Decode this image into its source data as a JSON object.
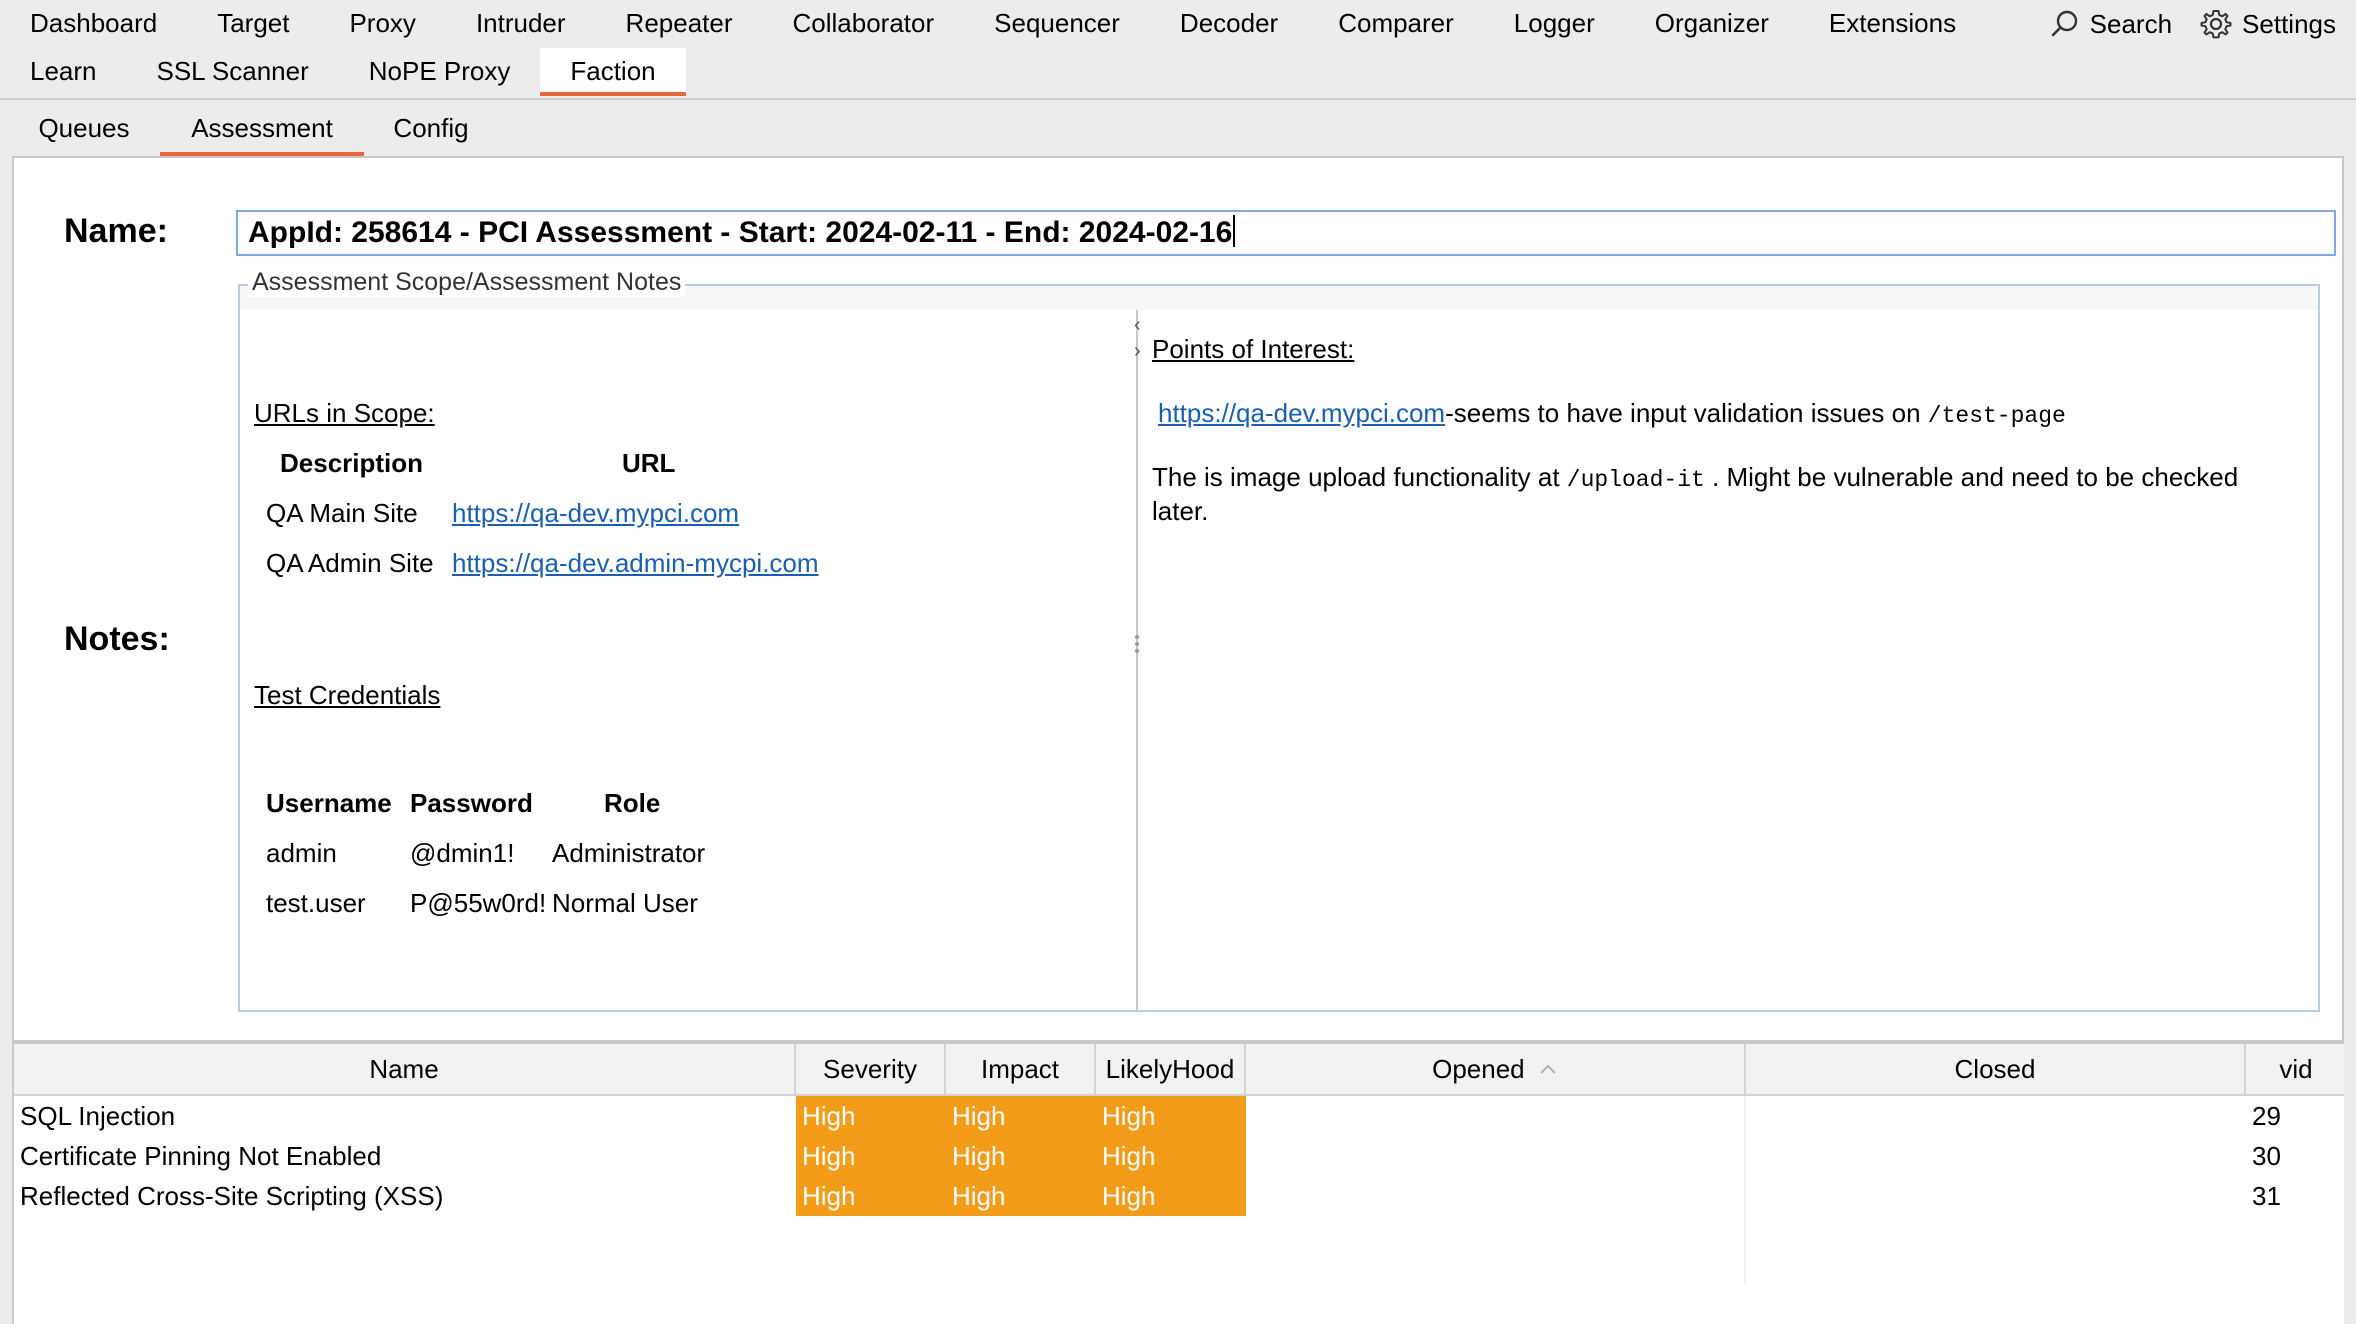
{
  "menu": {
    "row1": [
      "Dashboard",
      "Target",
      "Proxy",
      "Intruder",
      "Repeater",
      "Collaborator",
      "Sequencer",
      "Decoder",
      "Comparer",
      "Logger",
      "Organizer",
      "Extensions"
    ],
    "row2": [
      "Learn",
      "SSL Scanner",
      "NoPE Proxy",
      "Faction"
    ],
    "active": "Faction",
    "search_label": "Search",
    "settings_label": "Settings"
  },
  "subtabs": [
    "Queues",
    "Assessment",
    "Config"
  ],
  "active_subtab": "Assessment",
  "form": {
    "name_label": "Name:",
    "name_value": "AppId: 258614 - PCI Assessment - Start: 2024-02-11 - End: 2024-02-16",
    "notes_label": "Notes:",
    "notes_legend": "Assessment Scope/Assessment Notes"
  },
  "notes_left": {
    "urls_heading": "URLs in Scope:",
    "urls_headers": [
      "Description",
      "URL"
    ],
    "urls": [
      {
        "description": "QA Main Site",
        "url": "https://qa-dev.mypci.com"
      },
      {
        "description": "QA Admin Site",
        "url": "https://qa-dev.admin-mycpi.com"
      }
    ],
    "creds_heading": "Test Credentials",
    "creds_headers": [
      "Username",
      "Password",
      "Role"
    ],
    "creds": [
      {
        "username": "admin",
        "password": "@dmin1!",
        "role": "Administrator"
      },
      {
        "username": "test.user",
        "password": "P@55w0rd!",
        "role": "Normal User"
      }
    ]
  },
  "notes_right": {
    "heading": "Points of Interest:",
    "p1_link": "https://qa-dev.mypci.com",
    "p1_text": "-seems to have input validation issues on ",
    "p1_code": "/test-page",
    "p2_text_a": "The is image upload functionality at ",
    "p2_code": "/upload-it",
    "p2_text_b": " . Might be vulnerable and need to be checked",
    "p2_text_c": "later."
  },
  "table": {
    "headers": [
      "Name",
      "Severity",
      "Impact",
      "LikelyHood",
      "Opened",
      "Closed",
      "vid"
    ],
    "sort_column": "Opened",
    "sort_direction": "ascending",
    "severity_color": "#f39c19",
    "rows": [
      {
        "name": "SQL Injection",
        "severity": "High",
        "impact": "High",
        "likelyhood": "High",
        "opened": "",
        "closed": "",
        "vid": "29"
      },
      {
        "name": "Certificate Pinning Not Enabled",
        "severity": "High",
        "impact": "High",
        "likelyhood": "High",
        "opened": "",
        "closed": "",
        "vid": "30"
      },
      {
        "name": "Reflected Cross-Site Scripting (XSS)",
        "severity": "High",
        "impact": "High",
        "likelyhood": "High",
        "opened": "",
        "closed": "",
        "vid": "31"
      }
    ]
  },
  "colors": {
    "accent": "#e8643a",
    "link": "#1a5fb4",
    "input_border": "#7fa9e6"
  }
}
